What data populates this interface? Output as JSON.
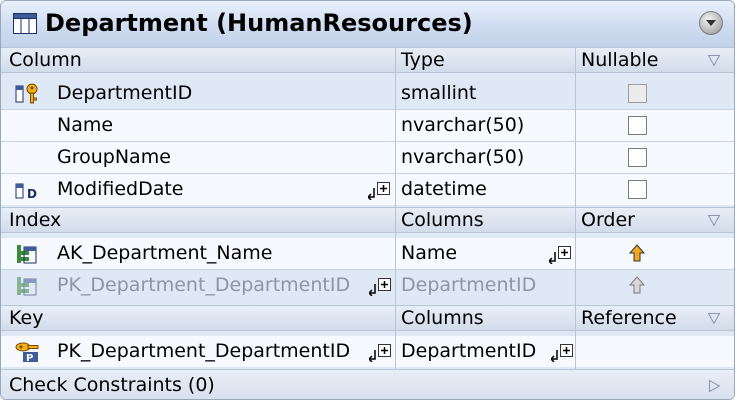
{
  "title": "Department (HumanResources)",
  "columns_section": {
    "headers": [
      "Column",
      "Type",
      "Nullable"
    ],
    "rows": [
      {
        "name": "DepartmentID",
        "type": "smallint",
        "icon": "primary-key-icon",
        "nullable": false,
        "nullable_disabled": true
      },
      {
        "name": "Name",
        "type": "nvarchar(50)",
        "icon": "",
        "nullable": false
      },
      {
        "name": "GroupName",
        "type": "nvarchar(50)",
        "icon": "",
        "nullable": false
      },
      {
        "name": "ModifiedDate",
        "type": "datetime",
        "icon": "default-value-icon",
        "nullable": false
      }
    ]
  },
  "index_section": {
    "headers": [
      "Index",
      "Columns",
      "Order"
    ],
    "rows": [
      {
        "name": "AK_Department_Name",
        "columns": "Name",
        "order": "ascending",
        "icon": "unique-index-icon"
      },
      {
        "name": "PK_Department_DepartmentID",
        "columns": "DepartmentID",
        "order": "ascending",
        "icon": "unique-index-icon",
        "dimmed": true
      }
    ]
  },
  "key_section": {
    "headers": [
      "Key",
      "Columns",
      "Reference"
    ],
    "rows": [
      {
        "name": "PK_Department_DepartmentID",
        "columns": "DepartmentID",
        "icon": "primary-key-icon"
      }
    ]
  },
  "check_constraints": {
    "label": "Check Constraints (0)"
  },
  "colors": {
    "panel_bg": "#dfe8f5",
    "row_bg": "#f6f9fd",
    "dim_text": "#8c96a4",
    "border": "#9aa8bc"
  }
}
